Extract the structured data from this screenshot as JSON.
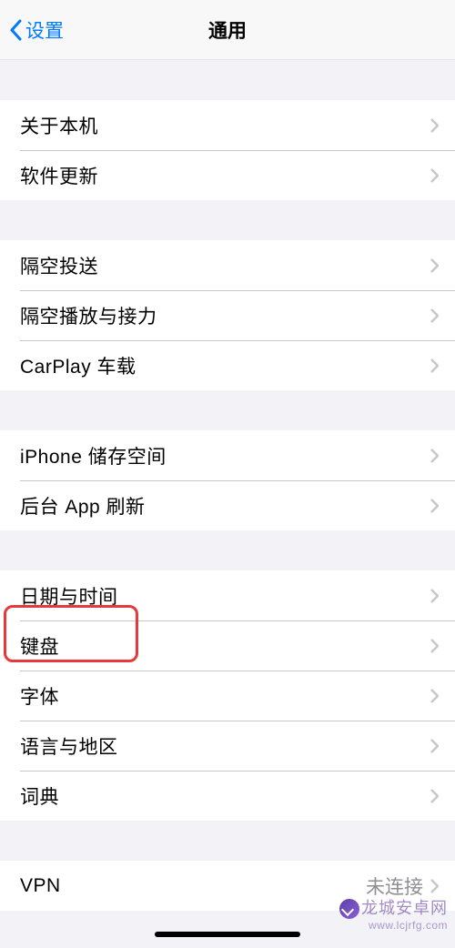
{
  "navbar": {
    "back_label": "设置",
    "title": "通用"
  },
  "groups": [
    {
      "items": [
        {
          "label": "关于本机"
        },
        {
          "label": "软件更新"
        }
      ]
    },
    {
      "items": [
        {
          "label": "隔空投送"
        },
        {
          "label": "隔空播放与接力"
        },
        {
          "label": "CarPlay 车载"
        }
      ]
    },
    {
      "items": [
        {
          "label": "iPhone 储存空间"
        },
        {
          "label": "后台 App 刷新"
        }
      ]
    },
    {
      "items": [
        {
          "label": "日期与时间"
        },
        {
          "label": "键盘",
          "highlighted": true
        },
        {
          "label": "字体"
        },
        {
          "label": "语言与地区"
        },
        {
          "label": "词典"
        }
      ]
    },
    {
      "items": [
        {
          "label": "VPN",
          "detail": "未连接"
        }
      ]
    }
  ],
  "watermark": {
    "line1": "龙城安卓网",
    "line2": "www.lcjrfg.com"
  }
}
